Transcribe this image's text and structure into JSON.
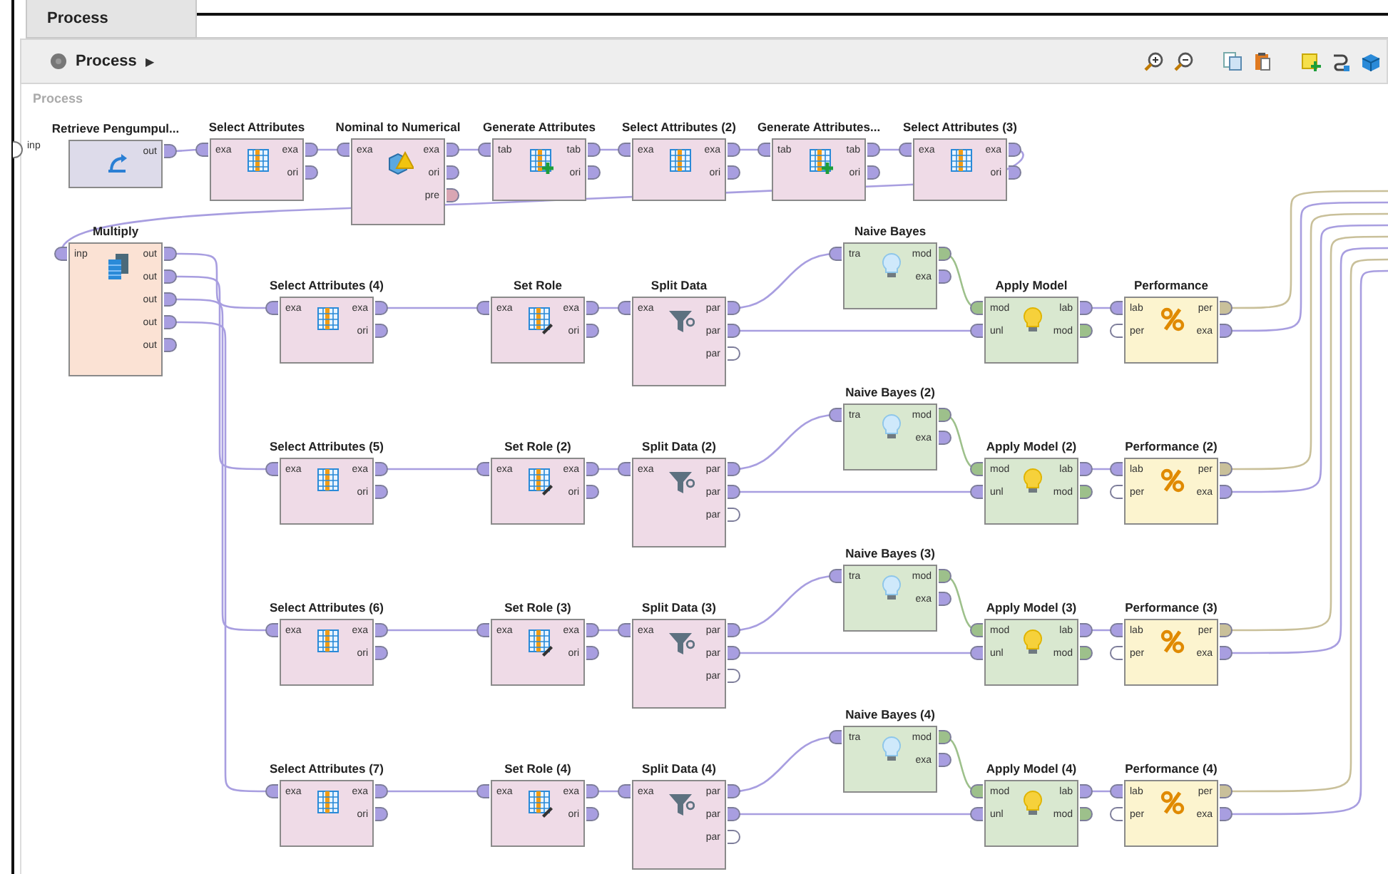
{
  "tab": {
    "label": "Process",
    "selected": true
  },
  "breadcrumb": {
    "label": "Process",
    "arrow": "▶"
  },
  "canvas": {
    "title": "Process",
    "input_port": {
      "label": "inp",
      "color": "#ffffff"
    }
  },
  "operators": [
    {
      "name": "Retrieve Pengumpul...",
      "kind": "retrieve",
      "outputs": [
        {
          "label": "out",
          "color": "#a89ee0"
        }
      ]
    },
    {
      "name": "Select Attributes",
      "kind": "select",
      "inputs": [
        {
          "label": "exa",
          "color": "#a89ee0"
        }
      ],
      "outputs": [
        {
          "label": "exa",
          "color": "#a89ee0"
        },
        {
          "label": "ori",
          "color": "#a89ee0"
        }
      ]
    },
    {
      "name": "Nominal to Numerical",
      "kind": "nominal",
      "inputs": [
        {
          "label": "exa",
          "color": "#a89ee0"
        }
      ],
      "outputs": [
        {
          "label": "exa",
          "color": "#a89ee0"
        },
        {
          "label": "ori",
          "color": "#a89ee0"
        },
        {
          "label": "pre",
          "color": "#d9a6b3"
        }
      ]
    },
    {
      "name": "Generate Attributes",
      "kind": "generate",
      "inputs": [
        {
          "label": "tab",
          "color": "#a89ee0"
        }
      ],
      "outputs": [
        {
          "label": "tab",
          "color": "#a89ee0"
        },
        {
          "label": "ori",
          "color": "#a89ee0"
        }
      ]
    },
    {
      "name": "Select Attributes (2)",
      "kind": "select",
      "inputs": [
        {
          "label": "exa",
          "color": "#a89ee0"
        }
      ],
      "outputs": [
        {
          "label": "exa",
          "color": "#a89ee0"
        },
        {
          "label": "ori",
          "color": "#a89ee0"
        }
      ]
    },
    {
      "name": "Generate Attributes...",
      "kind": "generate",
      "inputs": [
        {
          "label": "tab",
          "color": "#a89ee0"
        }
      ],
      "outputs": [
        {
          "label": "tab",
          "color": "#a89ee0"
        },
        {
          "label": "ori",
          "color": "#a89ee0"
        }
      ]
    },
    {
      "name": "Select Attributes (3)",
      "kind": "select",
      "inputs": [
        {
          "label": "exa",
          "color": "#a89ee0"
        }
      ],
      "outputs": [
        {
          "label": "exa",
          "color": "#a89ee0"
        },
        {
          "label": "ori",
          "color": "#a89ee0"
        }
      ]
    },
    {
      "name": "Multiply",
      "kind": "multiply",
      "inputs": [
        {
          "label": "inp",
          "color": "#a89ee0"
        }
      ],
      "outputs": [
        {
          "label": "out",
          "color": "#a89ee0"
        },
        {
          "label": "out",
          "color": "#a89ee0"
        },
        {
          "label": "out",
          "color": "#a89ee0"
        },
        {
          "label": "out",
          "color": "#a89ee0"
        },
        {
          "label": "out",
          "color": "#a89ee0"
        }
      ]
    },
    {
      "name": "Naive Bayes",
      "kind": "learner",
      "inputs": [
        {
          "label": "tra",
          "color": "#a89ee0"
        }
      ],
      "outputs": [
        {
          "label": "mod",
          "color": "#9dc08b"
        },
        {
          "label": "exa",
          "color": "#a89ee0"
        }
      ]
    },
    {
      "name": "Select Attributes (4)",
      "kind": "select",
      "inputs": [
        {
          "label": "exa",
          "color": "#a89ee0"
        }
      ],
      "outputs": [
        {
          "label": "exa",
          "color": "#a89ee0"
        },
        {
          "label": "ori",
          "color": "#a89ee0"
        }
      ]
    },
    {
      "name": "Set Role",
      "kind": "setrole",
      "inputs": [
        {
          "label": "exa",
          "color": "#a89ee0"
        }
      ],
      "outputs": [
        {
          "label": "exa",
          "color": "#a89ee0"
        },
        {
          "label": "ori",
          "color": "#a89ee0"
        }
      ]
    },
    {
      "name": "Split Data",
      "kind": "split",
      "inputs": [
        {
          "label": "exa",
          "color": "#a89ee0"
        }
      ],
      "outputs": [
        {
          "label": "par",
          "color": "#a89ee0"
        },
        {
          "label": "par",
          "color": "#a89ee0"
        },
        {
          "label": "par",
          "color": "#ffffff"
        }
      ]
    },
    {
      "name": "Apply Model",
      "kind": "apply",
      "inputs": [
        {
          "label": "mod",
          "color": "#9dc08b"
        },
        {
          "label": "unl",
          "color": "#a89ee0"
        }
      ],
      "outputs": [
        {
          "label": "lab",
          "color": "#a89ee0"
        },
        {
          "label": "mod",
          "color": "#9dc08b"
        }
      ]
    },
    {
      "name": "Performance",
      "kind": "performance",
      "inputs": [
        {
          "label": "lab",
          "color": "#a89ee0"
        },
        {
          "label": "per",
          "color": "#ffffff"
        }
      ],
      "outputs": [
        {
          "label": "per",
          "color": "#c9c09a"
        },
        {
          "label": "exa",
          "color": "#a89ee0"
        }
      ]
    },
    {
      "name": "Naive Bayes (2)",
      "kind": "learner",
      "inputs": [
        {
          "label": "tra",
          "color": "#a89ee0"
        }
      ],
      "outputs": [
        {
          "label": "mod",
          "color": "#9dc08b"
        },
        {
          "label": "exa",
          "color": "#a89ee0"
        }
      ]
    },
    {
      "name": "Select Attributes (5)",
      "kind": "select",
      "inputs": [
        {
          "label": "exa",
          "color": "#a89ee0"
        }
      ],
      "outputs": [
        {
          "label": "exa",
          "color": "#a89ee0"
        },
        {
          "label": "ori",
          "color": "#a89ee0"
        }
      ]
    },
    {
      "name": "Set Role (2)",
      "kind": "setrole",
      "inputs": [
        {
          "label": "exa",
          "color": "#a89ee0"
        }
      ],
      "outputs": [
        {
          "label": "exa",
          "color": "#a89ee0"
        },
        {
          "label": "ori",
          "color": "#a89ee0"
        }
      ]
    },
    {
      "name": "Split Data (2)",
      "kind": "split",
      "inputs": [
        {
          "label": "exa",
          "color": "#a89ee0"
        }
      ],
      "outputs": [
        {
          "label": "par",
          "color": "#a89ee0"
        },
        {
          "label": "par",
          "color": "#a89ee0"
        },
        {
          "label": "par",
          "color": "#ffffff"
        }
      ]
    },
    {
      "name": "Apply Model (2)",
      "kind": "apply",
      "inputs": [
        {
          "label": "mod",
          "color": "#9dc08b"
        },
        {
          "label": "unl",
          "color": "#a89ee0"
        }
      ],
      "outputs": [
        {
          "label": "lab",
          "color": "#a89ee0"
        },
        {
          "label": "mod",
          "color": "#9dc08b"
        }
      ]
    },
    {
      "name": "Performance (2)",
      "kind": "performance",
      "inputs": [
        {
          "label": "lab",
          "color": "#a89ee0"
        },
        {
          "label": "per",
          "color": "#ffffff"
        }
      ],
      "outputs": [
        {
          "label": "per",
          "color": "#c9c09a"
        },
        {
          "label": "exa",
          "color": "#a89ee0"
        }
      ]
    },
    {
      "name": "Naive Bayes (3)",
      "kind": "learner",
      "inputs": [
        {
          "label": "tra",
          "color": "#a89ee0"
        }
      ],
      "outputs": [
        {
          "label": "mod",
          "color": "#9dc08b"
        },
        {
          "label": "exa",
          "color": "#a89ee0"
        }
      ]
    },
    {
      "name": "Select Attributes (6)",
      "kind": "select",
      "inputs": [
        {
          "label": "exa",
          "color": "#a89ee0"
        }
      ],
      "outputs": [
        {
          "label": "exa",
          "color": "#a89ee0"
        },
        {
          "label": "ori",
          "color": "#a89ee0"
        }
      ]
    },
    {
      "name": "Set Role (3)",
      "kind": "setrole",
      "inputs": [
        {
          "label": "exa",
          "color": "#a89ee0"
        }
      ],
      "outputs": [
        {
          "label": "exa",
          "color": "#a89ee0"
        },
        {
          "label": "ori",
          "color": "#a89ee0"
        }
      ]
    },
    {
      "name": "Split Data (3)",
      "kind": "split",
      "inputs": [
        {
          "label": "exa",
          "color": "#a89ee0"
        }
      ],
      "outputs": [
        {
          "label": "par",
          "color": "#a89ee0"
        },
        {
          "label": "par",
          "color": "#a89ee0"
        },
        {
          "label": "par",
          "color": "#ffffff"
        }
      ]
    },
    {
      "name": "Apply Model (3)",
      "kind": "apply",
      "inputs": [
        {
          "label": "mod",
          "color": "#9dc08b"
        },
        {
          "label": "unl",
          "color": "#a89ee0"
        }
      ],
      "outputs": [
        {
          "label": "lab",
          "color": "#a89ee0"
        },
        {
          "label": "mod",
          "color": "#9dc08b"
        }
      ]
    },
    {
      "name": "Performance (3)",
      "kind": "performance",
      "inputs": [
        {
          "label": "lab",
          "color": "#a89ee0"
        },
        {
          "label": "per",
          "color": "#ffffff"
        }
      ],
      "outputs": [
        {
          "label": "per",
          "color": "#c9c09a"
        },
        {
          "label": "exa",
          "color": "#a89ee0"
        }
      ]
    },
    {
      "name": "Naive Bayes (4)",
      "kind": "learner",
      "inputs": [
        {
          "label": "tra",
          "color": "#a89ee0"
        }
      ],
      "outputs": [
        {
          "label": "mod",
          "color": "#9dc08b"
        },
        {
          "label": "exa",
          "color": "#a89ee0"
        }
      ]
    },
    {
      "name": "Select Attributes (7)",
      "kind": "select",
      "inputs": [
        {
          "label": "exa",
          "color": "#a89ee0"
        }
      ],
      "outputs": [
        {
          "label": "exa",
          "color": "#a89ee0"
        },
        {
          "label": "ori",
          "color": "#a89ee0"
        }
      ]
    },
    {
      "name": "Set Role (4)",
      "kind": "setrole",
      "inputs": [
        {
          "label": "exa",
          "color": "#a89ee0"
        }
      ],
      "outputs": [
        {
          "label": "exa",
          "color": "#a89ee0"
        },
        {
          "label": "ori",
          "color": "#a89ee0"
        }
      ]
    },
    {
      "name": "Split Data (4)",
      "kind": "split",
      "inputs": [
        {
          "label": "exa",
          "color": "#a89ee0"
        }
      ],
      "outputs": [
        {
          "label": "par",
          "color": "#a89ee0"
        },
        {
          "label": "par",
          "color": "#a89ee0"
        },
        {
          "label": "par",
          "color": "#ffffff"
        }
      ]
    },
    {
      "name": "Apply Model (4)",
      "kind": "apply",
      "inputs": [
        {
          "label": "mod",
          "color": "#9dc08b"
        },
        {
          "label": "unl",
          "color": "#a89ee0"
        }
      ],
      "outputs": [
        {
          "label": "lab",
          "color": "#a89ee0"
        },
        {
          "label": "mod",
          "color": "#9dc08b"
        }
      ]
    },
    {
      "name": "Performance (4)",
      "kind": "performance",
      "inputs": [
        {
          "label": "lab",
          "color": "#a89ee0"
        },
        {
          "label": "per",
          "color": "#ffffff"
        }
      ],
      "outputs": [
        {
          "label": "per",
          "color": "#c9c09a"
        },
        {
          "label": "exa",
          "color": "#a89ee0"
        }
      ]
    }
  ]
}
